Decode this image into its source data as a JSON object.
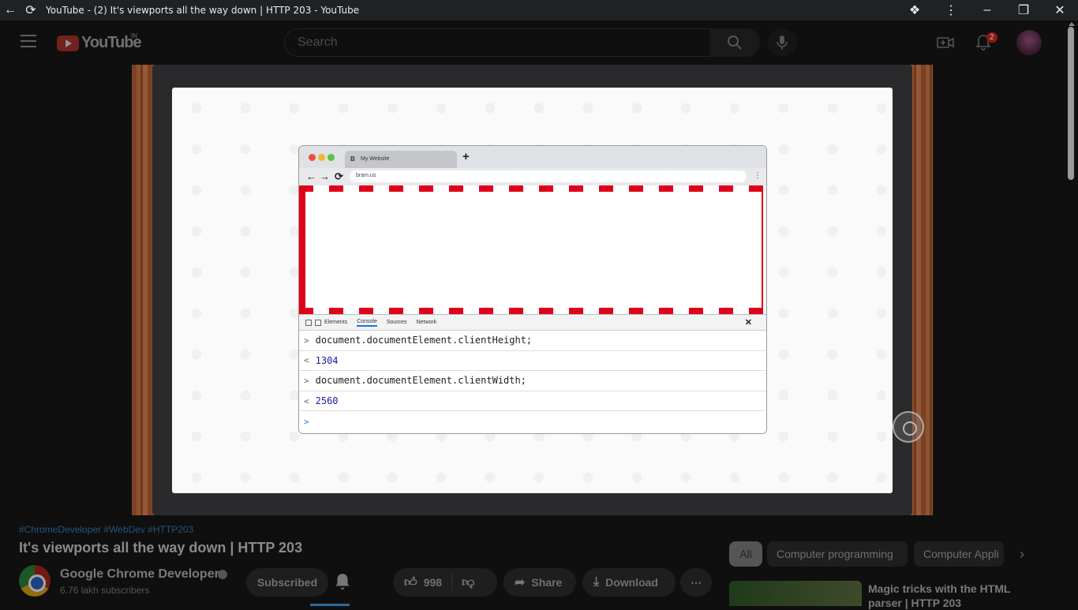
{
  "window": {
    "title": "YouTube - (2) It's viewports all the way down | HTTP 203 - YouTube",
    "icons": [
      "back-icon",
      "reload-icon",
      "extensions-icon",
      "more-vert-icon",
      "minimize-icon",
      "restore-icon",
      "close-icon"
    ]
  },
  "masthead": {
    "logo_text": "YouTube",
    "country_code": "IN",
    "search_placeholder": "Search",
    "notification_count": "2"
  },
  "video": {
    "inner_browser": {
      "tab_title": "My Website",
      "url": "bram.us",
      "devtools_tabs": [
        "Elements",
        "Console",
        "Sources",
        "Network"
      ],
      "active_tab": "Console",
      "console": [
        {
          "prefix": ">",
          "text": "document.documentElement.clientHeight;"
        },
        {
          "prefix": "<",
          "text": "1304"
        },
        {
          "prefix": ">",
          "text": "document.documentElement.clientWidth;"
        },
        {
          "prefix": "<",
          "text": "2560"
        },
        {
          "prefix": ">",
          "text": ""
        }
      ]
    }
  },
  "info": {
    "hashtags": "#ChromeDeveloper #WebDev #HTTP203",
    "title": "It's viewports all the way down | HTTP 203",
    "channel_name": "Google Chrome Developers",
    "subscribers": "6.76 lakh subscribers",
    "subscribed_label": "Subscribed",
    "like_count": "998",
    "share_label": "Share",
    "download_label": "Download"
  },
  "chips": [
    "All",
    "Computer programming",
    "Computer Appli"
  ],
  "recommendation": {
    "title": "Magic tricks with the HTML parser | HTTP 203"
  },
  "colors": {
    "background": "#0f0f0f",
    "viewport_dash": "#e0001a",
    "link": "#3ea6ff"
  }
}
